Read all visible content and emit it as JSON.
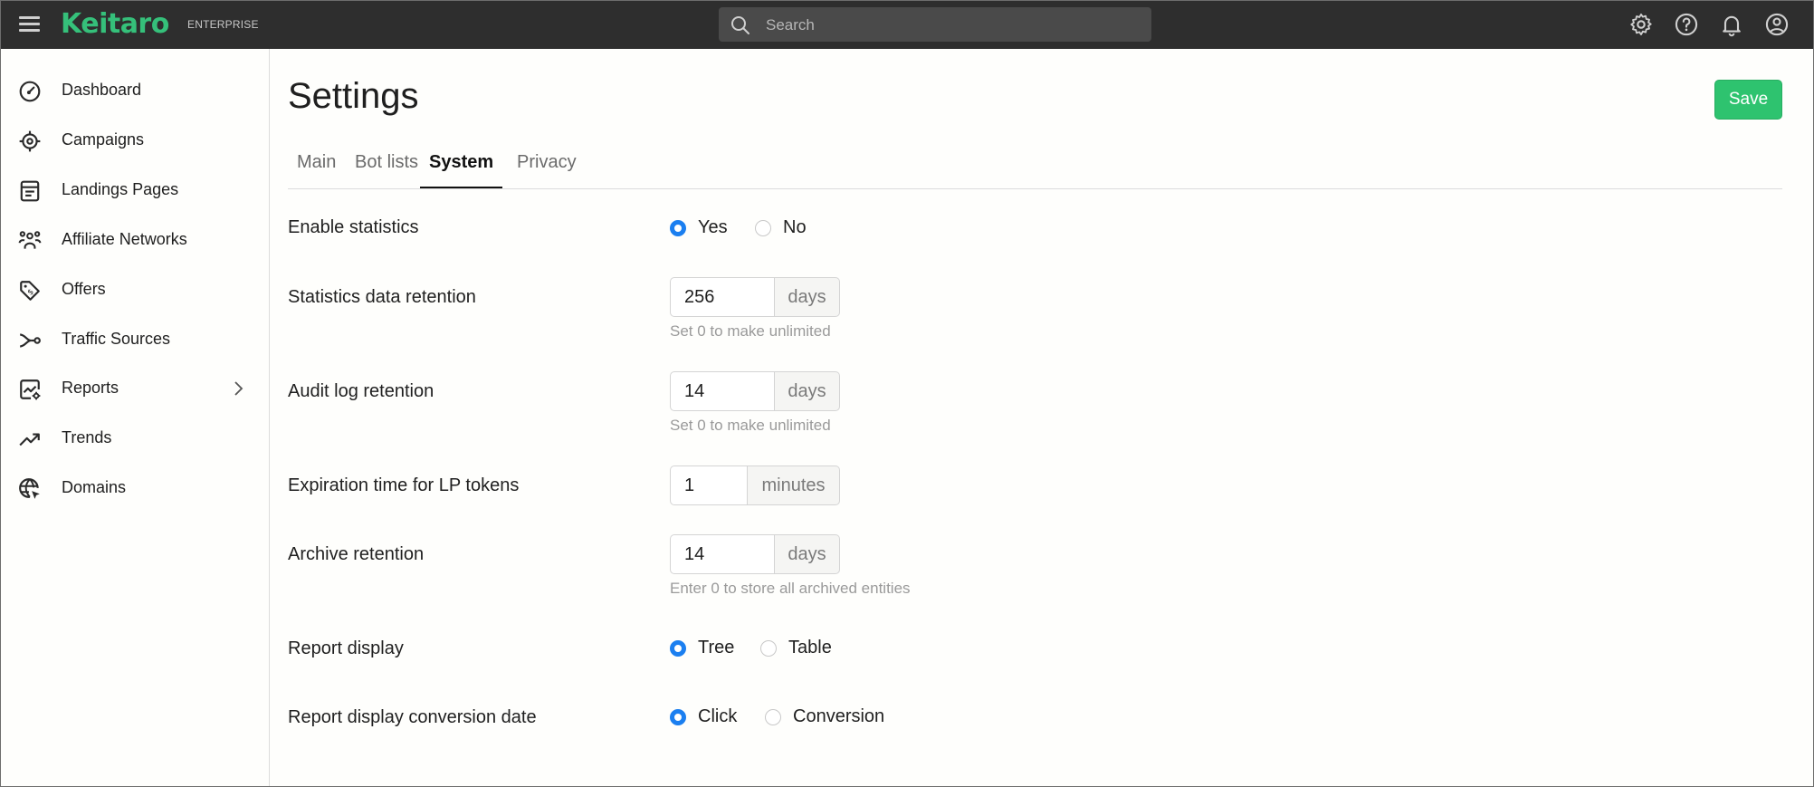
{
  "brand": {
    "name": "Keitaro",
    "edition": "ENTERPRISE",
    "accent": "#35c07a"
  },
  "search": {
    "placeholder": "Search"
  },
  "topbar_icons": [
    "gear-icon",
    "help-icon",
    "bell-icon",
    "account-icon"
  ],
  "sidebar": {
    "items": [
      {
        "label": "Dashboard",
        "icon": "dashboard-icon"
      },
      {
        "label": "Campaigns",
        "icon": "target-icon"
      },
      {
        "label": "Landings Pages",
        "icon": "landing-page-icon"
      },
      {
        "label": "Affiliate Networks",
        "icon": "affiliate-networks-icon"
      },
      {
        "label": "Offers",
        "icon": "offer-tag-icon"
      },
      {
        "label": "Traffic Sources",
        "icon": "traffic-sources-icon"
      },
      {
        "label": "Reports",
        "icon": "reports-icon"
      },
      {
        "label": "Trends",
        "icon": "trends-icon"
      },
      {
        "label": "Domains",
        "icon": "domains-icon"
      }
    ]
  },
  "page": {
    "title": "Settings",
    "save_label": "Save",
    "save_color": "#2ec36f"
  },
  "tabs": [
    {
      "label": "Main",
      "active": false
    },
    {
      "label": "Bot lists",
      "active": false
    },
    {
      "label": "System",
      "active": true
    },
    {
      "label": "Privacy",
      "active": false
    }
  ],
  "settings": {
    "enable_statistics": {
      "label": "Enable statistics",
      "options": [
        "Yes",
        "No"
      ],
      "selected": "Yes"
    },
    "statistics_retention": {
      "label": "Statistics data retention",
      "value": "256",
      "unit": "days",
      "hint": "Set 0 to make unlimited"
    },
    "audit_log_retention": {
      "label": "Audit log retention",
      "value": "14",
      "unit": "days",
      "hint": "Set 0 to make unlimited"
    },
    "lp_token_expiration": {
      "label": "Expiration time for LP tokens",
      "value": "1",
      "unit": "minutes"
    },
    "archive_retention": {
      "label": "Archive retention",
      "value": "14",
      "unit": "days",
      "hint": "Enter 0 to store all archived entities"
    },
    "report_display": {
      "label": "Report display",
      "options": [
        "Tree",
        "Table"
      ],
      "selected": "Tree"
    },
    "report_conversion_date": {
      "label": "Report display conversion date",
      "options": [
        "Click",
        "Conversion"
      ],
      "selected": "Click"
    }
  },
  "colors": {
    "radio_selected": "#1b7ff0",
    "topbar_bg": "#2e2e2e"
  }
}
